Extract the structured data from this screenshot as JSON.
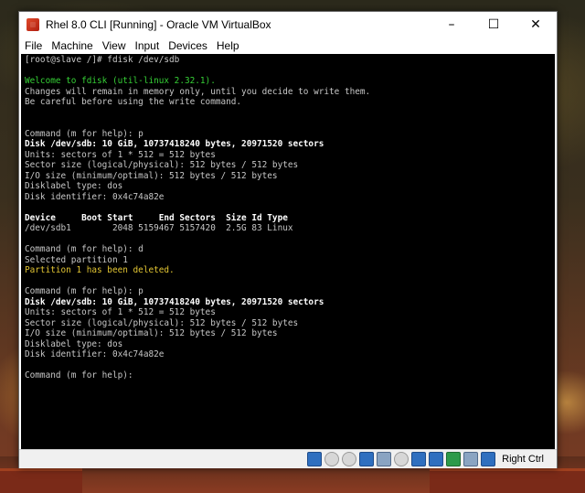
{
  "window": {
    "title": "Rhel 8.0 CLI [Running] - Oracle VM VirtualBox",
    "minimize": "–",
    "maximize": "☐",
    "close": "✕"
  },
  "menu": [
    "File",
    "Machine",
    "View",
    "Input",
    "Devices",
    "Help"
  ],
  "console": {
    "lines": [
      {
        "text": "[root@slave /]# fdisk /dev/sdb",
        "style": ""
      },
      {
        "text": "",
        "style": ""
      },
      {
        "text": "Welcome to fdisk (util-linux 2.32.1).",
        "style": "green"
      },
      {
        "text": "Changes will remain in memory only, until you decide to write them.",
        "style": ""
      },
      {
        "text": "Be careful before using the write command.",
        "style": ""
      },
      {
        "text": "",
        "style": ""
      },
      {
        "text": "",
        "style": ""
      },
      {
        "text": "Command (m for help): p",
        "style": ""
      },
      {
        "text": "Disk /dev/sdb: 10 GiB, 10737418240 bytes, 20971520 sectors",
        "style": "bold"
      },
      {
        "text": "Units: sectors of 1 * 512 = 512 bytes",
        "style": ""
      },
      {
        "text": "Sector size (logical/physical): 512 bytes / 512 bytes",
        "style": ""
      },
      {
        "text": "I/O size (minimum/optimal): 512 bytes / 512 bytes",
        "style": ""
      },
      {
        "text": "Disklabel type: dos",
        "style": ""
      },
      {
        "text": "Disk identifier: 0x4c74a82e",
        "style": ""
      },
      {
        "text": "",
        "style": ""
      },
      {
        "text": "Device     Boot Start     End Sectors  Size Id Type",
        "style": "bold"
      },
      {
        "text": "/dev/sdb1        2048 5159467 5157420  2.5G 83 Linux",
        "style": ""
      },
      {
        "text": "",
        "style": ""
      },
      {
        "text": "Command (m for help): d",
        "style": ""
      },
      {
        "text": "Selected partition 1",
        "style": ""
      },
      {
        "text": "Partition 1 has been deleted.",
        "style": "yellow"
      },
      {
        "text": "",
        "style": ""
      },
      {
        "text": "Command (m for help): p",
        "style": ""
      },
      {
        "text": "Disk /dev/sdb: 10 GiB, 10737418240 bytes, 20971520 sectors",
        "style": "bold"
      },
      {
        "text": "Units: sectors of 1 * 512 = 512 bytes",
        "style": ""
      },
      {
        "text": "Sector size (logical/physical): 512 bytes / 512 bytes",
        "style": ""
      },
      {
        "text": "I/O size (minimum/optimal): 512 bytes / 512 bytes",
        "style": ""
      },
      {
        "text": "Disklabel type: dos",
        "style": ""
      },
      {
        "text": "Disk identifier: 0x4c74a82e",
        "style": ""
      },
      {
        "text": "",
        "style": ""
      },
      {
        "text": "Command (m for help): ",
        "style": ""
      }
    ]
  },
  "statusbar": {
    "icons": [
      "hard-disk-icon",
      "optical-drive-icon",
      "audio-icon",
      "network-icon",
      "usb-icon",
      "shared-folders-icon",
      "display-icon",
      "video-capture-icon",
      "mouse-integration-icon",
      "host-key-arrow-icon"
    ],
    "host_key": "Right Ctrl"
  }
}
